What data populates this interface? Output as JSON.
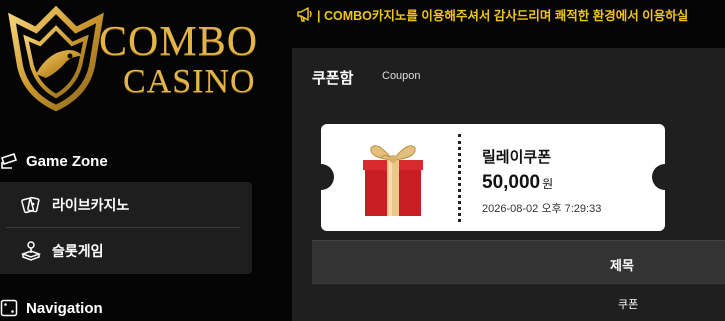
{
  "brand": {
    "line1": "COMBO",
    "line2": "CASINO",
    "gold": "#e2b449"
  },
  "sidebar": {
    "game_zone_label": "Game Zone",
    "game_zone_icon": "gamepad-icon",
    "items": [
      {
        "label": "라이브카지노",
        "icon": "cards-icon"
      },
      {
        "label": "슬롯게임",
        "icon": "joystick-icon"
      }
    ],
    "navigation_label": "Navigation",
    "navigation_icon": "dice-icon"
  },
  "ticker": {
    "icon": "megaphone-icon",
    "text": "| COMBO카지노를 이용해주셔서 감사드리며 쾌적한 환경에서 이용하실"
  },
  "coupon_box": {
    "title": "쿠폰함",
    "subtitle": "Coupon",
    "coupon": {
      "icon": "gift-icon",
      "name": "릴레이쿠폰",
      "amount": "50,000",
      "unit": "원",
      "date": "2026-08-02 오후 7:29:33"
    },
    "table": {
      "header_title": "제목",
      "rows": [
        {
          "title": "쿠폰"
        }
      ]
    }
  },
  "colors": {
    "ticker_text": "#f0c419",
    "panel_bg": "#1f1f1f",
    "menu_bg": "#1e1e1e"
  }
}
